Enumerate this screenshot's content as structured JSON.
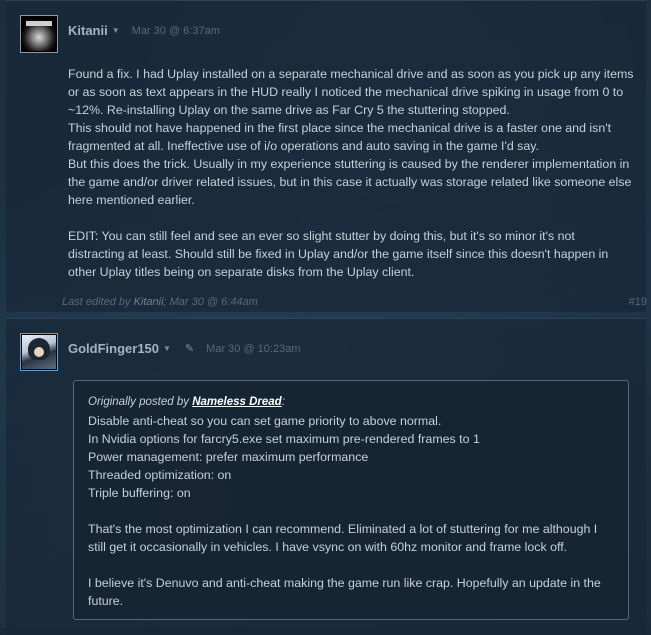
{
  "posts": [
    {
      "author": "Kitanii",
      "timestamp": "Mar 30 @ 6:37am",
      "paragraphs": [
        "Found a fix. I had Uplay installed on a separate mechanical drive and as soon as you pick up any items or as soon as text appears in the HUD really I noticed the mechanical drive spiking in usage from 0 to ~12%. Re-installing Uplay on the same drive as Far Cry 5 the stuttering stopped.\nThis should not have happened in the first place since the mechanical drive is a faster one and isn't fragmented at all. Ineffective use of i/o operations and auto saving in the game I'd say.\nBut this does the trick. Usually in my experience stuttering is caused by the renderer implementation in the game and/or driver related issues, but in this case it actually was storage related like someone else here mentioned earlier.",
        "EDIT: You can still feel and see an ever so slight stutter by doing this, but it's so minor it's not distracting at least. Should still be fixed in Uplay and/or the game itself since this doesn't happen in other Uplay titles being on separate disks from the Uplay client."
      ],
      "edited_prefix": "Last edited by ",
      "edited_by": "Kitanii",
      "edited_time": "; Mar 30 @ 6:44am",
      "post_number": "#19"
    },
    {
      "author": "GoldFinger150",
      "timestamp": "Mar 30 @ 10:23am",
      "quote": {
        "prefix": "Originally posted by ",
        "source": "Nameless Dread",
        "suffix": ":",
        "lines": [
          "Disable anti-cheat so you can set game priority to above normal.",
          "In Nvidia options for farcry5.exe set maximum pre-rendered frames to 1",
          "Power management: prefer maximum performance",
          "Threaded optimization: on",
          "Triple buffering: on"
        ],
        "para2": "That's the most optimization I can recommend. Eliminated a lot of stuttering for me although I still get it occasionally in vehicles. I have vsync on with 60hz monitor and frame lock off.",
        "para3": "I believe it's Denuvo and anti-cheat making the game run like crap. Hopefully an update in the future."
      }
    }
  ],
  "icons": {
    "caret": "▼",
    "pin": "✎"
  }
}
